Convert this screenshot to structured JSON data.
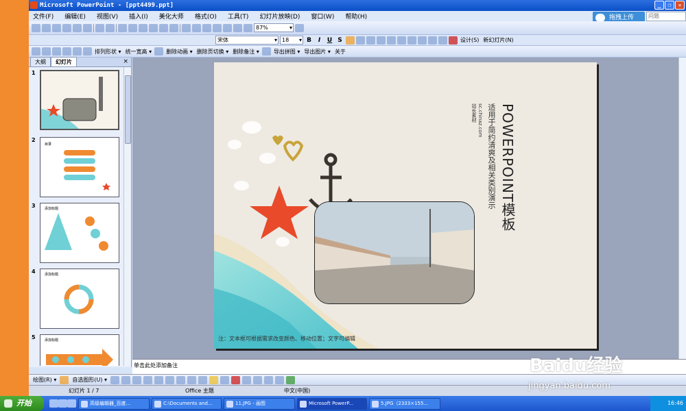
{
  "window": {
    "title": "Microsoft PowerPoint - [ppt4499.ppt]",
    "controls": [
      "_",
      "❐",
      "✕"
    ]
  },
  "menu": [
    "文件(F)",
    "编辑(E)",
    "视图(V)",
    "插入(I)",
    "美化大师",
    "格式(O)",
    "工具(T)",
    "幻灯片放映(D)",
    "窗口(W)",
    "帮助(H)"
  ],
  "upload_button": "拖拽上传",
  "help_placeholder": "问题",
  "toolbar1": {
    "zoom": "87%"
  },
  "toolbar2": {
    "font": "宋体",
    "size": "18",
    "design": "设计(S)",
    "new_slide": "新幻灯片(N)"
  },
  "toolbar3": [
    "排列形状 ▾",
    "统一宽高 ▾",
    "删除动画 ▾",
    "删除页切换 ▾",
    "删除备注 ▾",
    "导出拼图 ▾",
    "导出图片 ▾",
    "关于"
  ],
  "panel": {
    "tabs": [
      "大纲",
      "幻灯片"
    ],
    "close": "×",
    "slide_numbers": [
      "1",
      "2",
      "3",
      "4",
      "5"
    ]
  },
  "thumb_labels": {
    "t2": "目录",
    "t3": "添加标题",
    "t4": "添加标题",
    "t5": "添加标题"
  },
  "slide": {
    "title": "POWERPOINT模板",
    "subtitle": "适用于简约清爽及相关类别演示",
    "site": "sc.chinaz.com",
    "credit": "站长素材",
    "note": "注：文本框可根据需求改变颜色、移动位置；文字可编辑"
  },
  "notes_placeholder": "单击此处添加备注",
  "drawing": {
    "draw": "绘图(R) ▾",
    "autoshapes": "自选图形(U) ▾"
  },
  "status": {
    "slide": "幻灯片 1 / 7",
    "theme": "Office 主题",
    "lang": "中文(中国)"
  },
  "taskbar": {
    "start": "开始",
    "tasks": [
      "高级编辑器_百度...",
      "C:\\Documents and...",
      "11.JPG - 画图",
      "Microsoft PowerP...",
      "5.JPG（2333×155..."
    ],
    "clock": "16:46"
  },
  "watermark": {
    "brand": "Baidu经验",
    "url": "jingyan.baidu.com"
  },
  "colors": {
    "title_blue": "#0a4fc8",
    "sea": "#6fd0d6",
    "starfish": "#e84a2a",
    "thumb_orange": "#f08a30"
  }
}
